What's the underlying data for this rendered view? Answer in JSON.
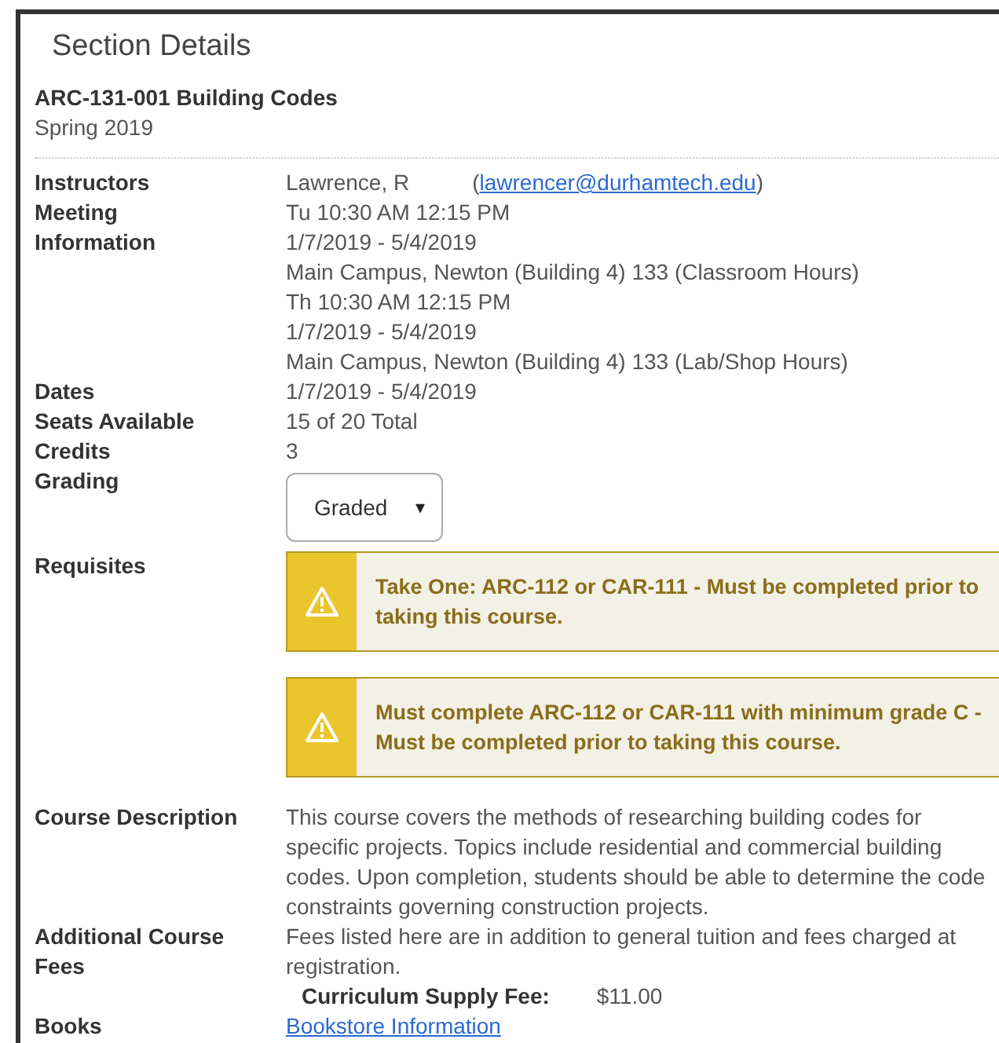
{
  "title": "Section Details",
  "course": {
    "name": "ARC-131-001 Building Codes",
    "term": "Spring 2019"
  },
  "rows": [
    {
      "kind": "instructor",
      "label": "Instructors",
      "name": "Lawrence, R",
      "email_open": "(",
      "email": "lawrencer@durhamtech.edu",
      "email_close": ")"
    },
    {
      "kind": "lines",
      "label": "Meeting Information",
      "lines": [
        "Tu 10:30 AM 12:15 PM",
        "1/7/2019 - 5/4/2019",
        "Main Campus, Newton (Building 4) 133 (Classroom Hours)",
        "Th 10:30 AM 12:15 PM",
        "1/7/2019 - 5/4/2019",
        "Main Campus, Newton (Building 4) 133 (Lab/Shop Hours)"
      ]
    },
    {
      "kind": "lines",
      "label": "Dates",
      "lines": [
        "1/7/2019 - 5/4/2019"
      ]
    },
    {
      "kind": "lines",
      "label": "Seats Available",
      "lines": [
        "15 of 20 Total"
      ]
    },
    {
      "kind": "lines",
      "label": "Credits",
      "lines": [
        "3"
      ]
    },
    {
      "kind": "select",
      "label": "Grading",
      "value": "Graded",
      "caret": "▾"
    },
    {
      "kind": "alerts",
      "label": "Requisites",
      "alerts": [
        "Take One: ARC-112 or CAR-111 - Must be completed prior to taking this course.",
        "Must complete ARC-112 or CAR-111 with minimum grade C - Must be completed prior to taking this course."
      ]
    },
    {
      "kind": "lines",
      "label": "Course Description",
      "lines": [
        "This course covers the methods of researching building codes for specific projects. Topics include residential and commercial building codes. Upon completion, students should be able to determine the code constraints governing construction projects."
      ]
    },
    {
      "kind": "fees",
      "label": "Additional Course Fees",
      "note": "Fees listed here are in addition to general tuition and fees charged at registration.",
      "fees": [
        {
          "name": "Curriculum Supply Fee:",
          "amount": "$11.00"
        }
      ]
    },
    {
      "kind": "link",
      "label": "Books",
      "text": "Bookstore Information"
    }
  ]
}
